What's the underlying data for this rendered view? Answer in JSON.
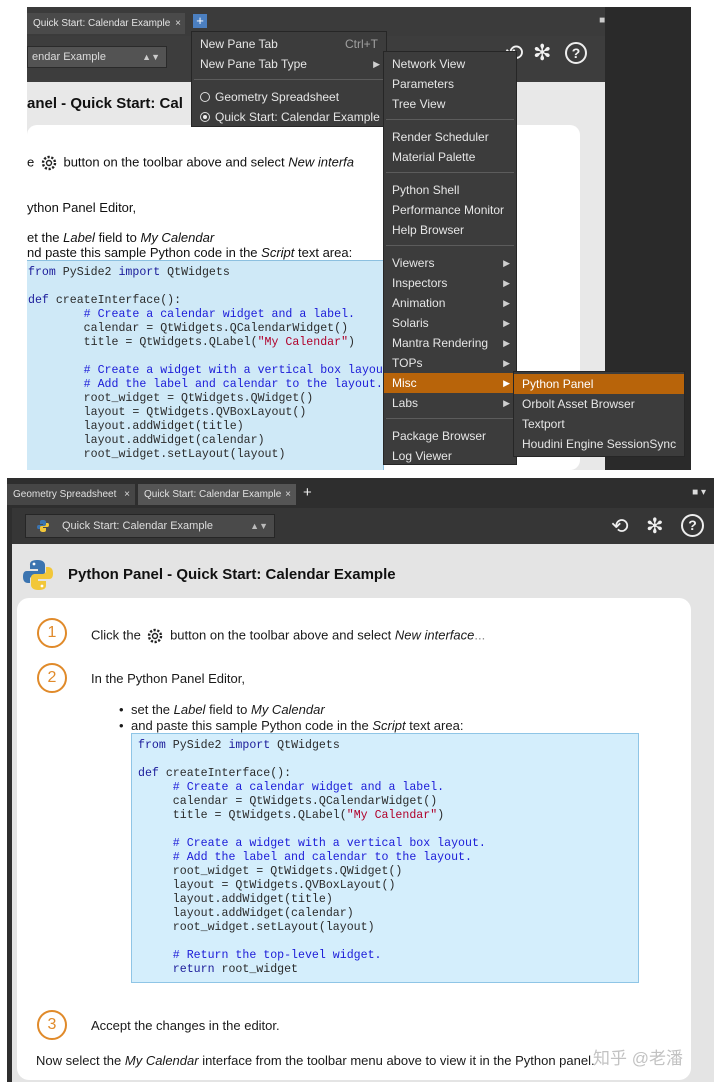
{
  "top": {
    "tab_label": "Quick Start: Calendar Example",
    "tab_close": "×",
    "new_tab_plus": "+",
    "dock_menu": "■ ▾",
    "combo_value": "endar Example",
    "combo_arrow": "▲▼",
    "title": "anel - Quick Start: Cal",
    "step1_text_a": "e",
    "step1_text_b": " button on the toolbar above and select ",
    "step1_italic": "New interfa",
    "editor_line": "ython Panel Editor,",
    "bullet1_a": "et the ",
    "bullet1_label": "Label",
    "bullet1_b": " field to ",
    "bullet1_val": "My Calendar",
    "bullet2_a": "nd paste this sample Python code in the ",
    "bullet2_script": "Script",
    "bullet2_b": " text area:",
    "code": {
      "l1_kw": "from",
      "l1_a": " PySide2 ",
      "l1_kw2": "import",
      "l1_b": " QtWidgets",
      "l2_kw": "def",
      "l2_a": " createInterface():",
      "l3": "        # Create a calendar widget and a label.",
      "l4": "        calendar = QtWidgets.QCalendarWidget()",
      "l5_a": "        title = QtWidgets.QLabel(",
      "l5_str": "\"My Calendar\"",
      "l5_b": ")",
      "l6": "        # Create a widget with a vertical box layout.",
      "l7": "        # Add the label and calendar to the layout.",
      "l8": "        root_widget = QtWidgets.QWidget()",
      "l9": "        layout = QtWidgets.QVBoxLayout()",
      "l10": "        layout.addWidget(title)",
      "l11": "        layout.addWidget(calendar)",
      "l12": "        root_widget.setLayout(layout)"
    },
    "menu1": {
      "new_pane_tab": "New Pane Tab",
      "new_pane_tab_shortcut": "Ctrl+T",
      "new_pane_tab_type": "New Pane Tab Type",
      "arrow": "▶",
      "radio_geo": "Geometry Spreadsheet",
      "radio_quick": "Quick Start: Calendar Example"
    },
    "menu2": {
      "items": [
        "Network View",
        "Parameters",
        "Tree View",
        "Render Scheduler",
        "Material Palette",
        "Python Shell",
        "Performance Monitor",
        "Help Browser",
        "Viewers",
        "Inspectors",
        "Animation",
        "Solaris",
        "Mantra Rendering",
        "TOPs",
        "Misc",
        "Labs",
        "Package Browser",
        "Log Viewer"
      ]
    },
    "menu3": {
      "items": [
        "Python Panel",
        "Orbolt Asset Browser",
        "Textport",
        "Houdini Engine SessionSync"
      ]
    }
  },
  "bottom": {
    "tab1": "Geometry Spreadsheet",
    "tab2": "Quick Start: Calendar Example",
    "tab_close": "×",
    "plus": "+",
    "dock_menu": "■ ▾",
    "combo_value": "Quick Start: Calendar Example",
    "combo_arrow": "▲▼",
    "title": "Python Panel - Quick Start: Calendar Example",
    "n1": "1",
    "n2": "2",
    "n3": "3",
    "step1_a": "Click the ",
    "step1_b": " button on the toolbar above and select ",
    "step1_italic": "New interface",
    "step1_dots": "...",
    "step2": "In the Python Panel Editor,",
    "bullet1_a": "set the ",
    "bullet1_label": "Label",
    "bullet1_b": " field to ",
    "bullet1_val": "My Calendar",
    "bullet2_a": "and paste this sample Python code in the ",
    "bullet2_script": "Script",
    "bullet2_b": " text area:",
    "code": {
      "l1_kw": "from",
      "l1_a": " PySide2 ",
      "l1_kw2": "import",
      "l1_b": " QtWidgets",
      "l2_kw": "def",
      "l2_a": " createInterface():",
      "l3": "     # Create a calendar widget and a label.",
      "l4": "     calendar = QtWidgets.QCalendarWidget()",
      "l5_a": "     title = QtWidgets.QLabel(",
      "l5_str": "\"My Calendar\"",
      "l5_b": ")",
      "l6": "     # Create a widget with a vertical box layout.",
      "l7": "     # Add the label and calendar to the layout.",
      "l8": "     root_widget = QtWidgets.QWidget()",
      "l9": "     layout = QtWidgets.QVBoxLayout()",
      "l10": "     layout.addWidget(title)",
      "l11": "     layout.addWidget(calendar)",
      "l12": "     root_widget.setLayout(layout)",
      "l13": "     # Return the top-level widget.",
      "l14_kw": "     return",
      "l14_a": " root_widget"
    },
    "step3": "Accept the changes in the editor.",
    "final_a": "Now select the ",
    "final_italic": "My Calendar",
    "final_b": " interface from the toolbar menu above to view it in the Python panel.",
    "watermark": "知乎 @老潘"
  },
  "colors": {
    "menu_bg": "#3c3c3c",
    "menu_highlight": "#b8640a",
    "step_circle": "#e08a2a",
    "code_bg": "#d4eefc"
  }
}
